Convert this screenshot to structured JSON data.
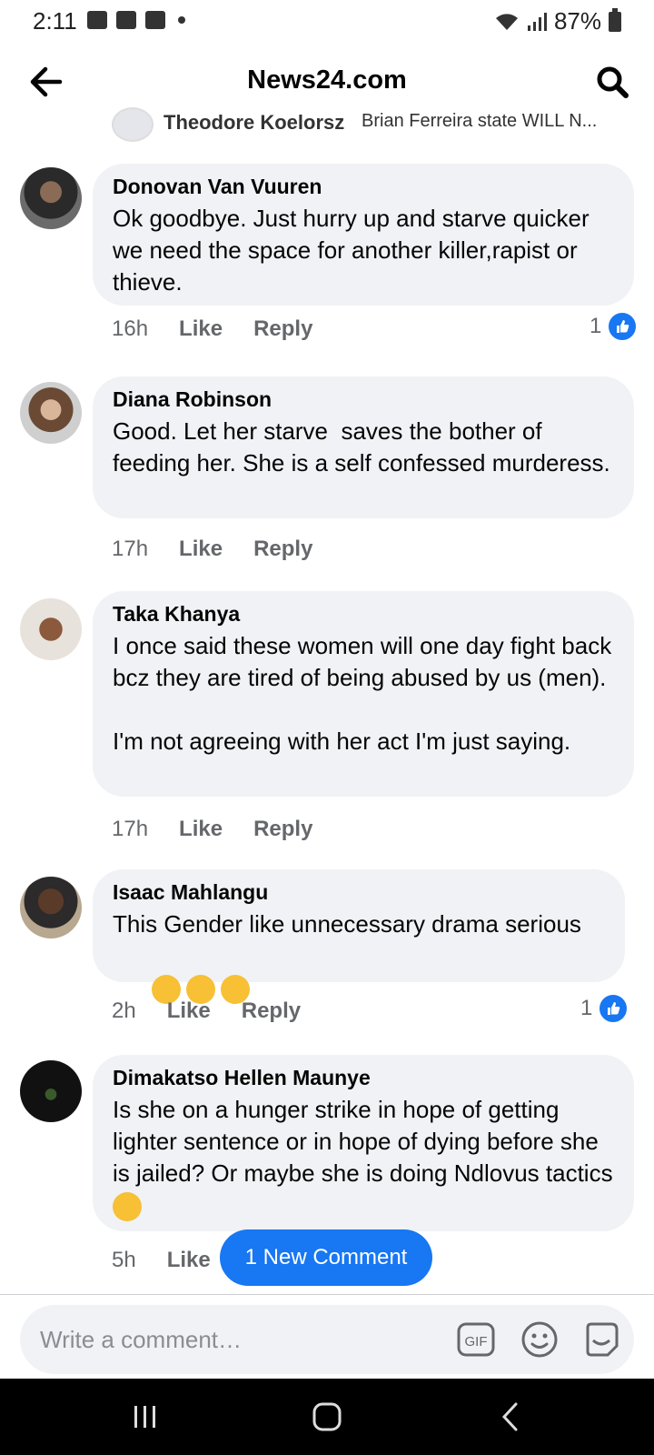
{
  "status": {
    "time": "2:11",
    "battery": "87%"
  },
  "header": {
    "title": "News24.com"
  },
  "partial_comment": {
    "name": "Theodore Koelorsz",
    "text": "Brian Ferreira state WILL N..."
  },
  "comments": [
    {
      "name": "Donovan Van Vuuren",
      "text": "Ok goodbye. Just hurry up and starve quicker we need the space for another killer,rapist or thieve.",
      "time": "16h",
      "like": "Like",
      "reply": "Reply",
      "reactions": "1"
    },
    {
      "name": "Diana Robinson",
      "text": "Good. Let her starve  saves the bother of feeding her. She is a self confessed murderess.",
      "time": "17h",
      "like": "Like",
      "reply": "Reply",
      "reactions": ""
    },
    {
      "name": "Taka Khanya",
      "text": "I once said these women will one day fight back bcz they are tired of being abused by us (men).\n\nI'm not agreeing with her act I'm just saying.",
      "time": "17h",
      "like": "Like",
      "reply": "Reply",
      "reactions": ""
    },
    {
      "name": "Isaac Mahlangu",
      "text": "This Gender like unnecessary drama serious",
      "time": "2h",
      "like": "Like",
      "reply": "Reply",
      "reactions": "1"
    },
    {
      "name": "Dimakatso Hellen Maunye",
      "text": "Is she on a hunger strike in hope of getting lighter sentence or in hope of dying before she is jailed? Or maybe she is doing Ndlovus tactics",
      "time": "5h",
      "like": "Like",
      "reply": "Reply",
      "reactions": ""
    }
  ],
  "new_comment_pill": "1 New Comment",
  "composer": {
    "placeholder": "Write a comment…",
    "gif_label": "GIF"
  },
  "colors": {
    "accent": "#1877f2",
    "bubble": "#f0f2f5",
    "meta": "#65676b"
  },
  "icons": [
    "back-arrow-icon",
    "search-icon",
    "like-icon",
    "gif-icon",
    "emoji-icon",
    "sticker-icon",
    "recent-apps-icon",
    "home-icon",
    "nav-back-icon"
  ]
}
